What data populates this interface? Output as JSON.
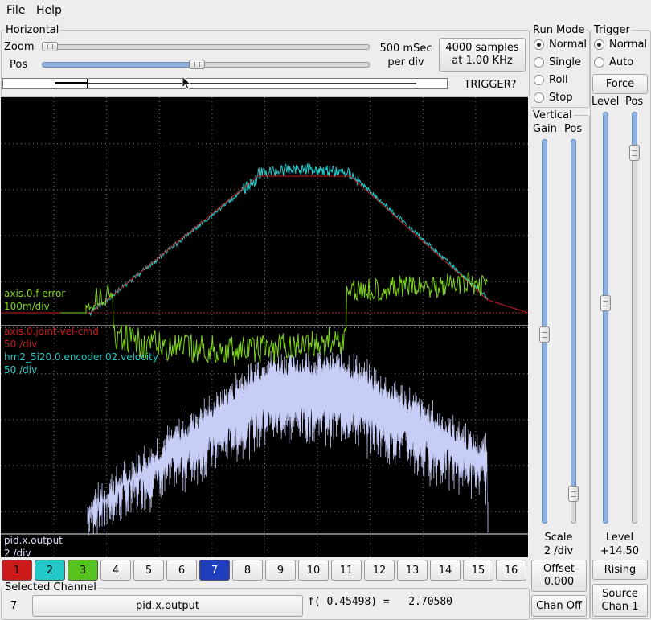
{
  "menu": {
    "file": "File",
    "help": "Help"
  },
  "horizontal": {
    "title": "Horizontal",
    "zoom_label": "Zoom",
    "pos_label": "Pos",
    "time_div_line1": "500 mSec",
    "time_div_line2": "per div",
    "samples_line1": "4000 samples",
    "samples_line2": "at 1.00 KHz",
    "trigger_status": "TRIGGER?"
  },
  "run_mode": {
    "title": "Run Mode",
    "options": [
      "Normal",
      "Single",
      "Roll",
      "Stop"
    ],
    "selected": "Normal"
  },
  "trigger": {
    "title": "Trigger",
    "options": [
      "Normal",
      "Auto"
    ],
    "selected": "Normal",
    "force_label": "Force",
    "level_label": "Level",
    "pos_label": "Pos",
    "level_caption": "Level",
    "level_value": "+14.50",
    "edge_label": "Rising",
    "source_line1": "Source",
    "source_line2": "Chan  1"
  },
  "vertical": {
    "title": "Vertical",
    "gain_label": "Gain",
    "pos_label": "Pos",
    "scale_caption": "Scale",
    "scale_value": "2 /div",
    "offset_line1": "Offset",
    "offset_line2": "0.000",
    "chan_off_label": "Chan Off"
  },
  "scope": {
    "traces": [
      {
        "name": "axis.0.f-error",
        "scale": "100m/div",
        "color": "#7fd41b"
      },
      {
        "name": "axis.0.joint-vel-cmd",
        "scale": "50 /div",
        "color": "#cc1a1a"
      },
      {
        "name": "hm2_5i20.0.encoder.02.velocity",
        "scale": "50 /div",
        "color": "#22c7c7"
      },
      {
        "name": "pid.x.output",
        "scale": "2 /div",
        "color": "#c7cdf7"
      }
    ]
  },
  "channels": [
    {
      "label": "1",
      "color": "#cc1a1a"
    },
    {
      "label": "2",
      "color": "#22c7c7"
    },
    {
      "label": "3",
      "color": "#55c21e"
    },
    {
      "label": "4",
      "color": ""
    },
    {
      "label": "5",
      "color": ""
    },
    {
      "label": "6",
      "color": ""
    },
    {
      "label": "7",
      "color": "#1f3fbf"
    },
    {
      "label": "8",
      "color": ""
    },
    {
      "label": "9",
      "color": ""
    },
    {
      "label": "10",
      "color": ""
    },
    {
      "label": "11",
      "color": ""
    },
    {
      "label": "12",
      "color": ""
    },
    {
      "label": "13",
      "color": ""
    },
    {
      "label": "14",
      "color": ""
    },
    {
      "label": "15",
      "color": ""
    },
    {
      "label": "16",
      "color": ""
    }
  ],
  "selected_channel": {
    "title": "Selected Channel",
    "number": "7",
    "name": "pid.x.output",
    "readout": "f( 0.45498) =   2.70580"
  }
}
